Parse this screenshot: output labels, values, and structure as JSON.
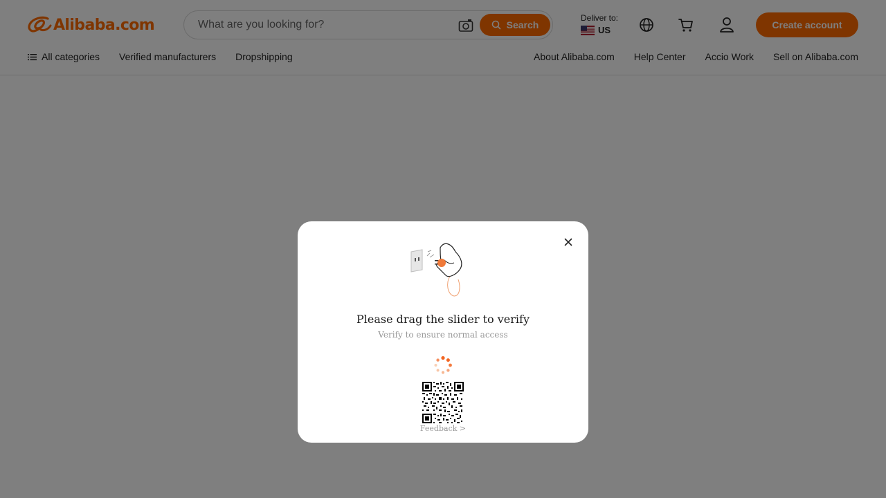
{
  "header": {
    "logo_text": "Alibaba.com",
    "search": {
      "placeholder": "What are you looking for?",
      "camera_icon": "camera-icon",
      "button_label": "Search"
    },
    "deliver": {
      "label": "Deliver to:",
      "country": "US",
      "flag_icon": "us-flag-icon"
    },
    "icons": [
      "globe-icon",
      "cart-icon",
      "user-icon"
    ],
    "create_account": "Create account"
  },
  "nav": {
    "left": [
      {
        "label": "All categories",
        "icon": "menu-icon"
      },
      {
        "label": "Verified manufacturers"
      },
      {
        "label": "Dropshipping"
      }
    ],
    "right": [
      {
        "label": "About Alibaba.com"
      },
      {
        "label": "Help Center"
      },
      {
        "label": "Accio Work"
      },
      {
        "label": "Sell on Alibaba.com"
      }
    ]
  },
  "modal": {
    "title": "Please drag the slider to verify",
    "subtitle": "Verify to ensure normal access",
    "feedback": "Feedback >",
    "close_icon": "close-icon",
    "illustration_icon": "plug-illustration-icon",
    "spinner_icon": "loading-spinner-icon",
    "qr_icon": "qr-code-icon"
  },
  "colors": {
    "brand": "#ff6a00",
    "overlay": "rgba(0,0,0,0.5)"
  }
}
